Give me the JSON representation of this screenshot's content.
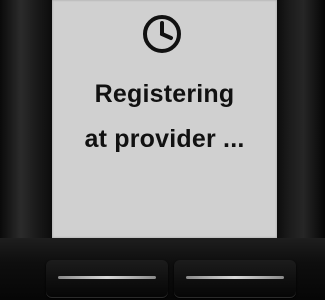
{
  "display": {
    "status_icon": "clock-icon",
    "status_line1": "Registering",
    "status_line2": "at provider ..."
  },
  "soft_keys": {
    "left": {
      "label": ""
    },
    "right": {
      "label": ""
    }
  },
  "colors": {
    "screen_background": "#d0d0d0",
    "text": "#111111",
    "body": "#101010"
  }
}
